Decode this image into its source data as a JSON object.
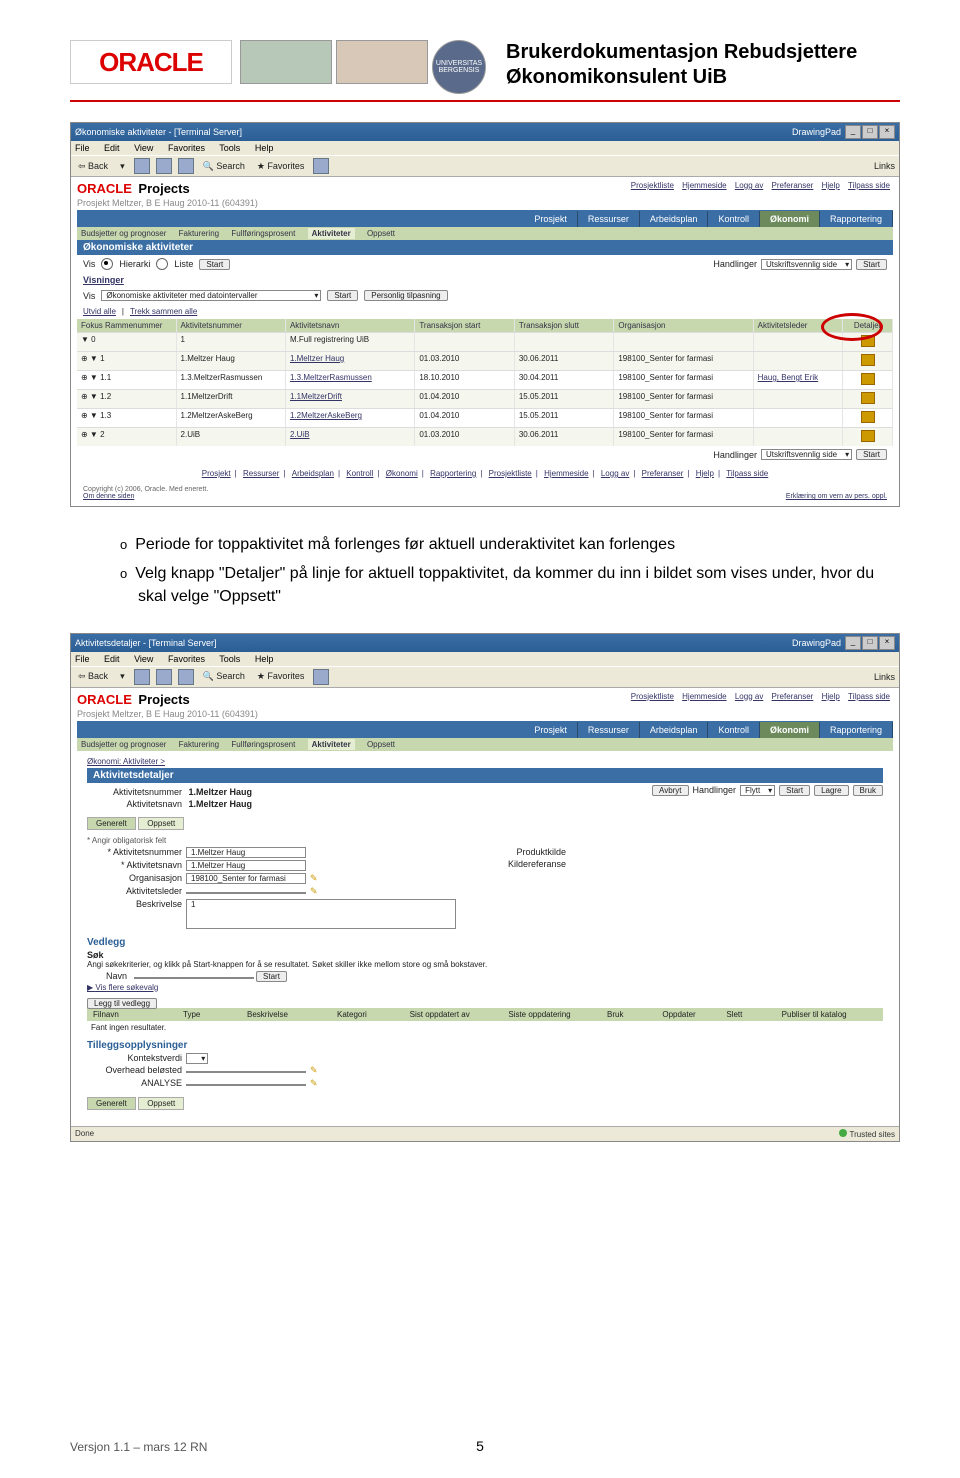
{
  "header": {
    "oracle": "ORACLE",
    "seal": "UNIVERSITAS BERGENSIS",
    "title_line1": "Brukerdokumentasjon Rebudsjettere",
    "title_line2": "Økonomikonsulent UiB"
  },
  "screenshot1": {
    "window_title": "Økonomiske aktiviteter - [Terminal Server]",
    "drawing_pad": "DrawingPad",
    "menu": {
      "file": "File",
      "edit": "Edit",
      "view": "View",
      "fav": "Favorites",
      "tools": "Tools",
      "help": "Help"
    },
    "toolbar": {
      "back": "Back",
      "search": "Search",
      "favorites": "Favorites",
      "links": "Links"
    },
    "oracle": "ORACLE",
    "projects": "Projects",
    "top_links": [
      "Prosjektliste",
      "Hjemmeside",
      "Logg av",
      "Preferanser",
      "Hjelp",
      "Tilpass side"
    ],
    "proj_title": "Prosjekt Meltzer, B E Haug 2010-11 (604391)",
    "main_tabs": [
      "Prosjekt",
      "Ressurser",
      "Arbeidsplan",
      "Kontroll",
      "Økonomi",
      "Rapportering"
    ],
    "main_tab_active": "Økonomi",
    "sub_tabs": [
      "Budsjetter og prognoser",
      "Fakturering",
      "Fullføringsprosent",
      "Aktiviteter",
      "Oppsett"
    ],
    "sub_tab_active": "Aktiviteter",
    "section_title": "Økonomiske aktiviteter",
    "vis_label": "Vis",
    "radio_hierarki": "Hierarki",
    "radio_liste": "Liste",
    "start_btn": "Start",
    "handlinger": "Handlinger",
    "handling_value": "Utskriftsvennlig side",
    "visninger": "Visninger",
    "vis_select": "Økonomiske aktiviteter med datointervaller",
    "personlig": "Personlig tilpasning",
    "utvid": "Utvid alle",
    "trekk": "Trekk sammen alle",
    "columns": {
      "fokus": "Fokus Rammenummer",
      "anum": "Aktivitetsnummer",
      "anavn": "Aktivitetsnavn",
      "tstart": "Transaksjon start",
      "tslutt": "Transaksjon slutt",
      "org": "Organisasjon",
      "aled": "Aktivitetsleder",
      "det": "Detaljer"
    },
    "filter_row": {
      "fokus": "0",
      "anum": "1",
      "anavn": "M.Full registrering UiB"
    },
    "rows": [
      {
        "fokus": "1",
        "anum": "1.Meltzer Haug",
        "anavn": "1.Meltzer Haug",
        "tstart": "01.03.2010",
        "tslutt": "30.06.2011",
        "org": "198100_Senter for farmasi"
      },
      {
        "fokus": "1.1",
        "anum": "1.3.MeltzerRasmussen",
        "anavn": "1.3.MeltzerRasmussen",
        "tstart": "18.10.2010",
        "tslutt": "30.04.2011",
        "org": "198100_Senter for farmasi",
        "aled": "Haug, Bengt Erik"
      },
      {
        "fokus": "1.2",
        "anum": "1.1MeltzerDrift",
        "anavn": "1.1MeltzerDrift",
        "tstart": "01.04.2010",
        "tslutt": "15.05.2011",
        "org": "198100_Senter for farmasi"
      },
      {
        "fokus": "1.3",
        "anum": "1.2MeltzerAskeBerg",
        "anavn": "1.2MeltzerAskeBerg",
        "tstart": "01.04.2010",
        "tslutt": "15.05.2011",
        "org": "198100_Senter for farmasi"
      },
      {
        "fokus": "2",
        "anum": "2.UiB",
        "anavn": "2.UiB",
        "tstart": "01.03.2010",
        "tslutt": "30.06.2011",
        "org": "198100_Senter for farmasi"
      }
    ],
    "footer_links": [
      "Prosjekt",
      "Ressurser",
      "Arbeidsplan",
      "Kontroll",
      "Økonomi",
      "Rapportering",
      "Prosjektliste",
      "Hjemmeside",
      "Logg av",
      "Preferanser",
      "Hjelp",
      "Tilpass side"
    ],
    "copyright": "Copyright (c) 2006, Oracle. Med enerett.",
    "om": "Om denne siden",
    "erklaring": "Erklæring om vern av pers. oppl."
  },
  "body_text": {
    "b1": "Periode for toppaktivitet må forlenges før aktuell underaktivitet kan forlenges",
    "b2": "Velg knapp \"Detaljer\" på linje for aktuell toppaktivitet, da kommer du inn i bildet som vises under, hvor du skal velge \"Oppsett\""
  },
  "screenshot2": {
    "window_title": "Aktivitetsdetaljer - [Terminal Server]",
    "drawing_pad": "DrawingPad",
    "menu": {
      "file": "File",
      "edit": "Edit",
      "view": "View",
      "fav": "Favorites",
      "tools": "Tools",
      "help": "Help"
    },
    "toolbar": {
      "back": "Back",
      "search": "Search",
      "favorites": "Favorites",
      "links": "Links"
    },
    "oracle": "ORACLE",
    "projects": "Projects",
    "top_links": [
      "Prosjektliste",
      "Hjemmeside",
      "Logg av",
      "Preferanser",
      "Hjelp",
      "Tilpass side"
    ],
    "proj_title": "Prosjekt Meltzer, B E Haug 2010-11 (604391)",
    "main_tabs": [
      "Prosjekt",
      "Ressurser",
      "Arbeidsplan",
      "Kontroll",
      "Økonomi",
      "Rapportering"
    ],
    "main_tab_active": "Økonomi",
    "sub_tabs": [
      "Budsjetter og prognoser",
      "Fakturering",
      "Fullføringsprosent",
      "Aktiviteter",
      "Oppsett"
    ],
    "sub_tab_active": "Aktiviteter",
    "breadcrumb": "Økonomi: Aktiviteter >",
    "section": "Aktivitetsdetaljer",
    "line1_lbl": "Aktivitetsnummer",
    "line1_val": "1.Meltzer Haug",
    "line2_lbl": "Aktivitetsnavn",
    "line2_val": "1.Meltzer Haug",
    "right_btns": {
      "avbryt": "Avbryt",
      "handlinger": "Handlinger",
      "flytt": "Flytt",
      "start": "Start",
      "lagre": "Lagre",
      "bruk": "Bruk"
    },
    "tabs2": {
      "generelt": "Generelt",
      "oppsett": "Oppsett"
    },
    "mandatory": "Angir obligatorisk felt",
    "f_anum_lbl": "* Aktivitetsnummer",
    "f_anum_val": "1.Meltzer Haug",
    "f_anavn_lbl": "* Aktivitetsnavn",
    "f_anavn_val": "1.Meltzer Haug",
    "f_org_lbl": "Organisasjon",
    "f_org_val": "198100_Senter for farmasi",
    "f_aled_lbl": "Aktivitetsleder",
    "f_besk_lbl": "Beskrivelse",
    "f_besk_val": "1",
    "f_prod_lbl": "Produktkilde",
    "f_kilde_lbl": "Kildereferanse",
    "vedlegg": "Vedlegg",
    "sok": "Søk",
    "sok_hint": "Angi søkekriterier, og klikk på Start-knappen for å se resultatet. Søket skiller ikke mellom store og små bokstaver.",
    "navn_lbl": "Navn",
    "start_btn": "Start",
    "vis_flere": "Vis flere søkevalg",
    "legg_til": "Legg til vedlegg",
    "att_cols": [
      "Filnavn",
      "Type",
      "Beskrivelse",
      "Kategori",
      "Sist oppdatert av",
      "Siste oppdatering",
      "Bruk",
      "Oppdater",
      "Slett",
      "Publiser til katalog"
    ],
    "no_results": "Fant ingen resultater.",
    "tillegg": "Tilleggsopplysninger",
    "kontekst": "Kontekstverdi",
    "overhead": "Overhead beløsted",
    "analyse": "ANALYSE",
    "bottom_tabs": {
      "generelt": "Generelt",
      "oppsett": "Oppsett"
    },
    "status_done": "Done",
    "status_trusted": "Trusted sites"
  },
  "footer": {
    "version": "Versjon 1.1 – mars 12 RN",
    "page": "5"
  }
}
